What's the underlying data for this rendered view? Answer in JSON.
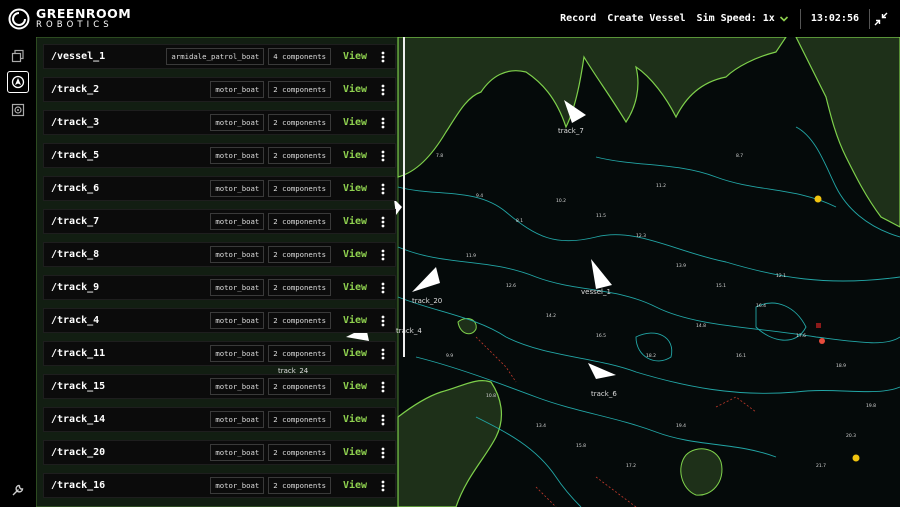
{
  "brand": {
    "line1": "GREENROOM",
    "line2": "ROBOTICS"
  },
  "topbar": {
    "record_label": "Record",
    "create_vessel_label": "Create Vessel",
    "sim_speed_label": "Sim Speed: 1x",
    "clock": "13:02:56"
  },
  "rail": {
    "items": [
      {
        "name": "layers-icon",
        "active": false
      },
      {
        "name": "entities-icon",
        "active": true
      },
      {
        "name": "sensor-icon",
        "active": false
      }
    ],
    "bottom_icon": "wrench-icon"
  },
  "vessels": [
    {
      "name": "/vessel_1",
      "type": "armidale_patrol_boat",
      "components": "4 components",
      "action": "View"
    },
    {
      "name": "/track_2",
      "type": "motor_boat",
      "components": "2 components",
      "action": "View"
    },
    {
      "name": "/track_3",
      "type": "motor_boat",
      "components": "2 components",
      "action": "View"
    },
    {
      "name": "/track_5",
      "type": "motor_boat",
      "components": "2 components",
      "action": "View"
    },
    {
      "name": "/track_6",
      "type": "motor_boat",
      "components": "2 components",
      "action": "View"
    },
    {
      "name": "/track_7",
      "type": "motor_boat",
      "components": "2 components",
      "action": "View"
    },
    {
      "name": "/track_8",
      "type": "motor_boat",
      "components": "2 components",
      "action": "View"
    },
    {
      "name": "/track_9",
      "type": "motor_boat",
      "components": "2 components",
      "action": "View"
    },
    {
      "name": "/track_4",
      "type": "motor_boat",
      "components": "2 components",
      "action": "View"
    },
    {
      "name": "/track_11",
      "type": "motor_boat",
      "components": "2 components",
      "action": "View"
    },
    {
      "name": "/track_15",
      "type": "motor_boat",
      "components": "2 components",
      "action": "View"
    },
    {
      "name": "/track_14",
      "type": "motor_boat",
      "components": "2 components",
      "action": "View"
    },
    {
      "name": "/track_20",
      "type": "motor_boat",
      "components": "2 components",
      "action": "View"
    },
    {
      "name": "/track_16",
      "type": "motor_boat",
      "components": "2 components",
      "action": "View"
    }
  ],
  "map": {
    "labels": [
      "track_7",
      "vessel_1",
      "track_20",
      "track_4",
      "track_6",
      "track_24"
    ],
    "depth_soundings": [
      "7.8",
      "9.4",
      "8.1",
      "10.2",
      "11.5",
      "12.3",
      "13.9",
      "15.1",
      "16.4",
      "17.6",
      "18.9",
      "19.8",
      "20.3",
      "21.7",
      "11.9",
      "12.6",
      "14.2",
      "16.5",
      "18.2",
      "9.9",
      "10.8",
      "13.4",
      "15.8",
      "17.2",
      "19.4",
      "8.7",
      "14.8",
      "16.1",
      "12.1",
      "11.2"
    ],
    "colors": {
      "land": "#1e3019",
      "land_edge": "#7ed04b",
      "water": "#050a0a",
      "contour": "#22a6a6",
      "hazard": "#c0392b",
      "buoy": "#f1c40f"
    }
  }
}
